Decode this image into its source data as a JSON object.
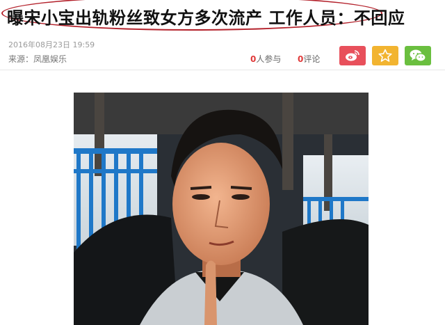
{
  "article": {
    "headline": "曝宋小宝出轨粉丝致女方多次流产 工作人员：不回应",
    "date": "2016年08月23日 19:59",
    "source": "来源：凤凰娱乐"
  },
  "stats": {
    "participants_count": "0",
    "participants_label": "人参与",
    "comments_count": "0",
    "comments_label": "评论"
  },
  "share": {
    "weibo": {
      "icon": "weibo-icon",
      "color": "#e8505b"
    },
    "favorite": {
      "icon": "star-icon",
      "color": "#f2b430"
    },
    "wechat": {
      "icon": "wechat-icon",
      "color": "#6abf3f"
    }
  },
  "annotation": {
    "color": "#b3202a"
  }
}
